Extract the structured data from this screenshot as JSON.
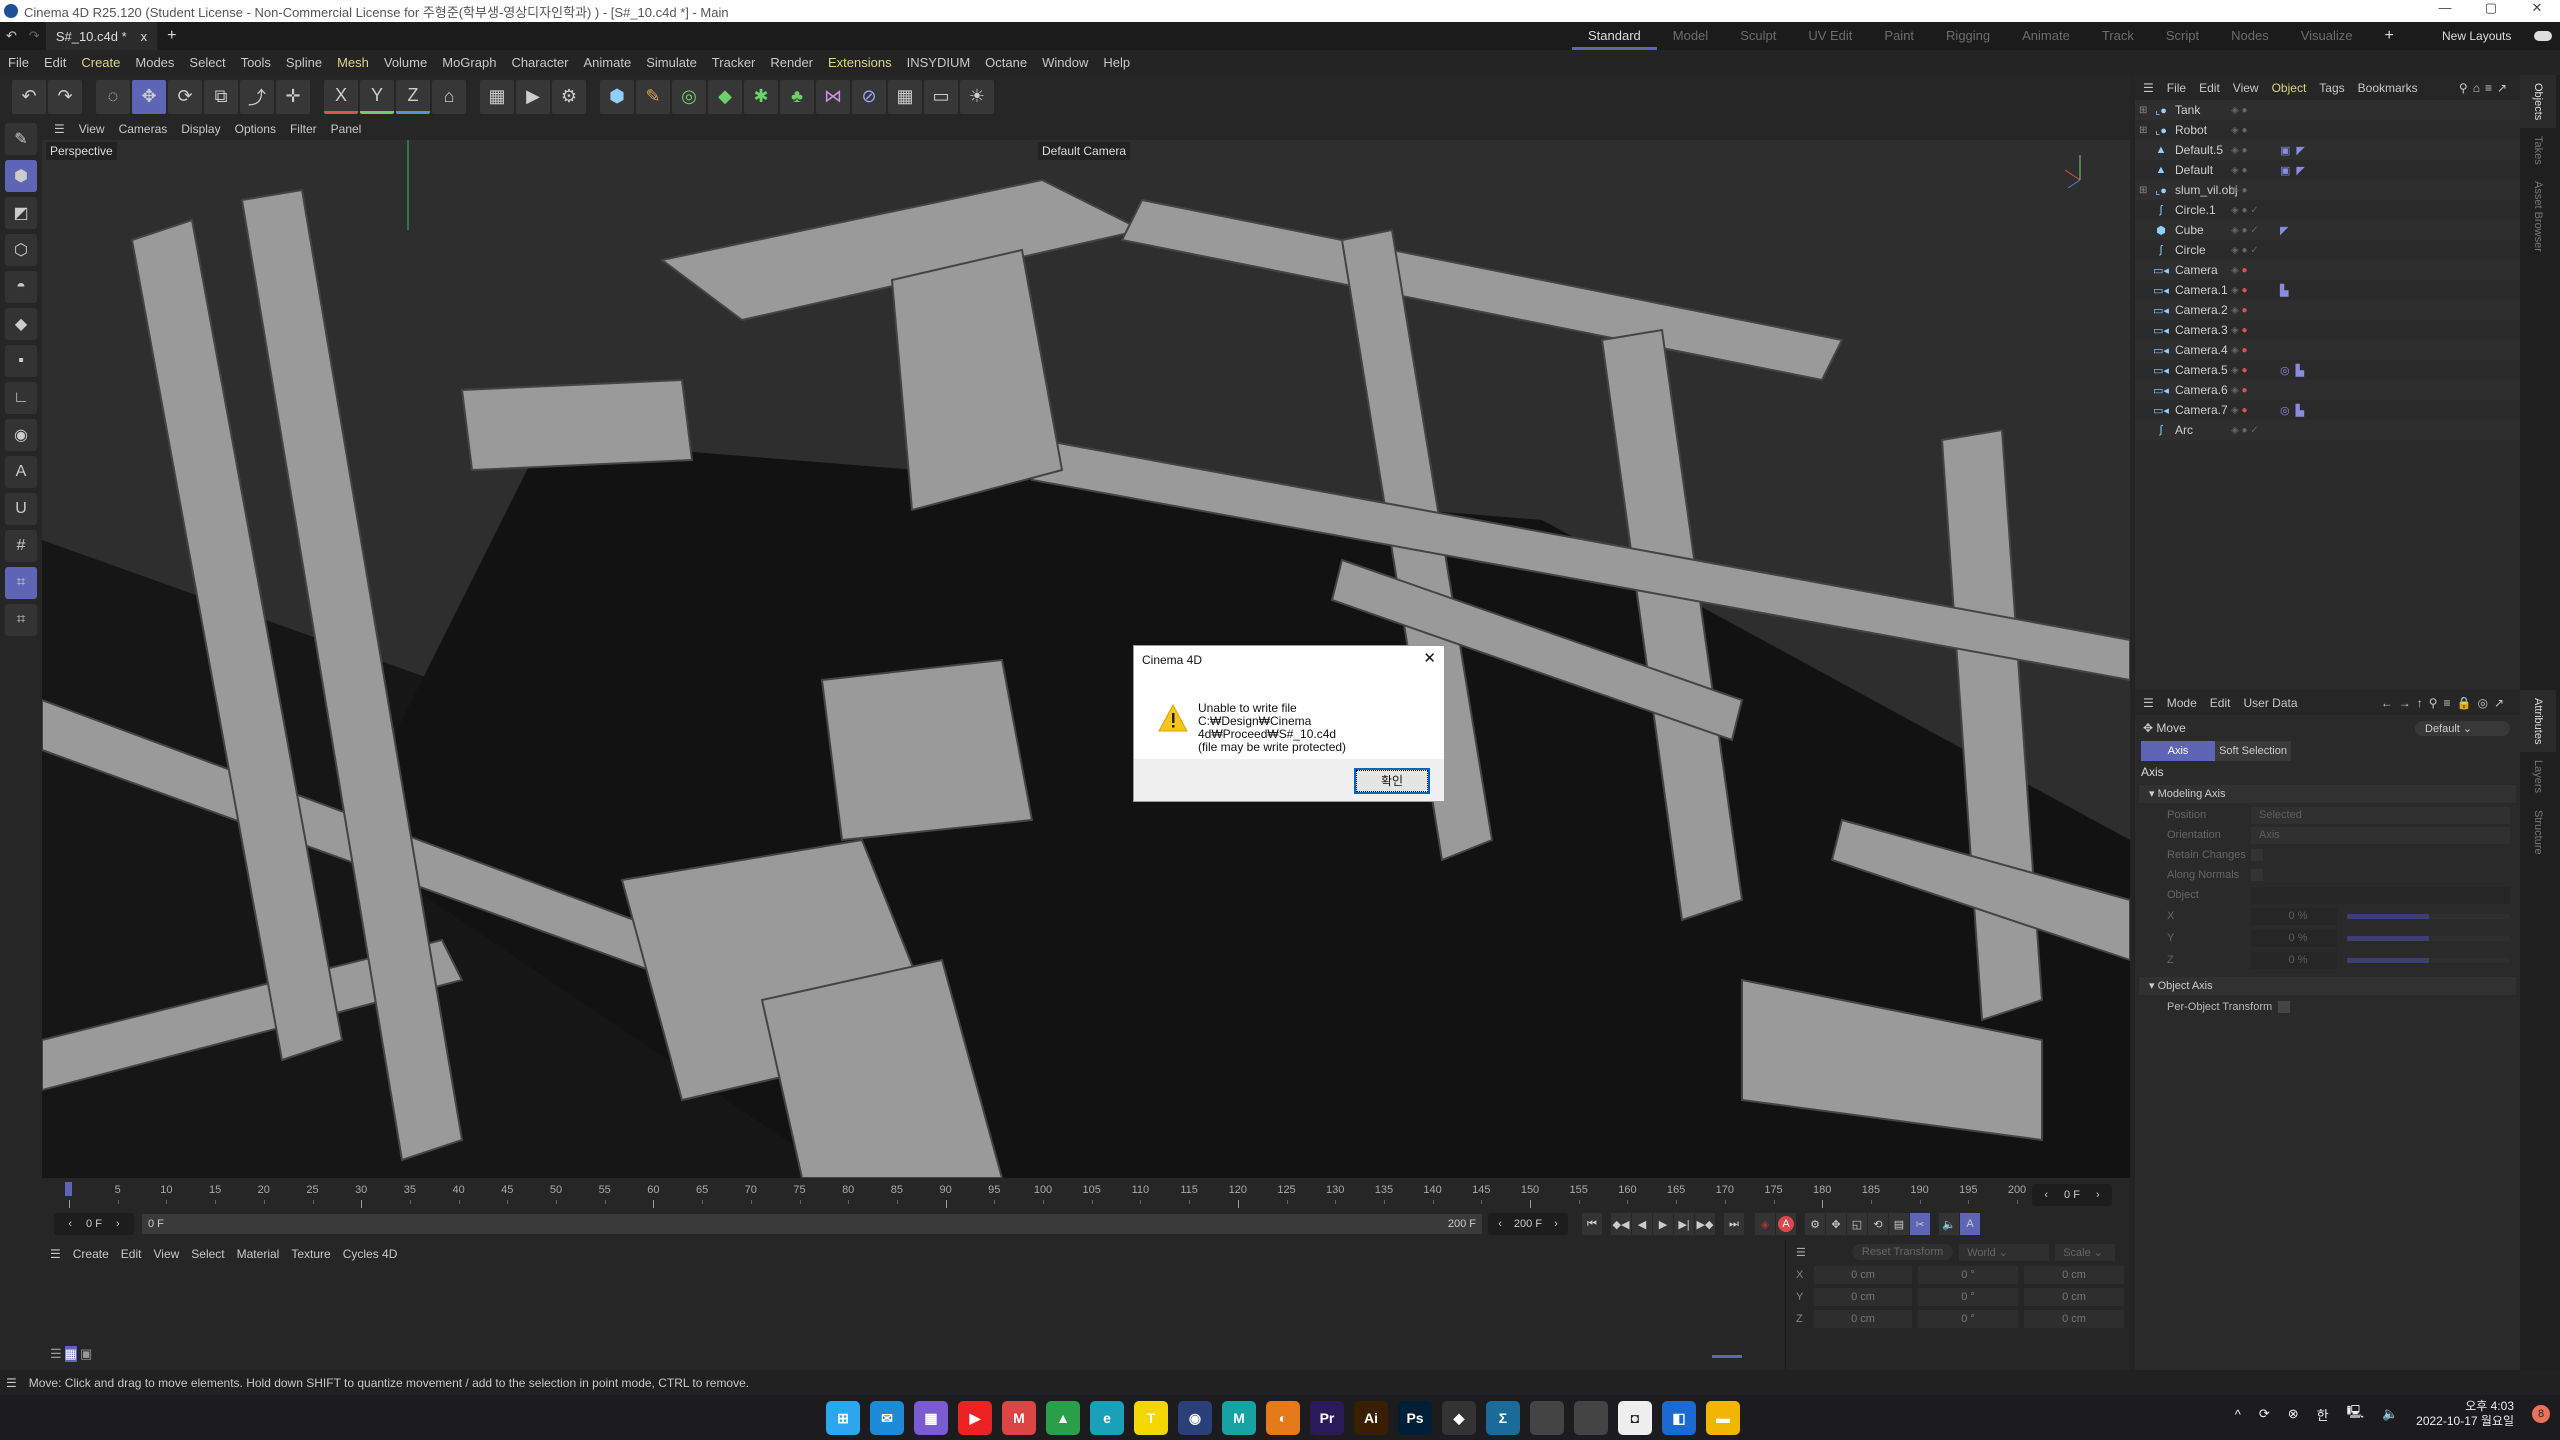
{
  "window": {
    "title": "Cinema 4D R25.120 (Student License - Non-Commercial License for 주형준(학부생-영상디자인학과) ) - [S#_10.c4d *] - Main",
    "controls": [
      "—",
      "▢",
      "✕"
    ]
  },
  "tabs": {
    "document": "S#_10.c4d *",
    "close": "x",
    "add": "+"
  },
  "layouts": {
    "items": [
      "Standard",
      "Model",
      "Sculpt",
      "UV Edit",
      "Paint",
      "Rigging",
      "Animate",
      "Track",
      "Script",
      "Nodes",
      "Visualize"
    ],
    "active": "Standard",
    "add": "+",
    "new_layouts": "New Layouts"
  },
  "menu": [
    "File",
    "Edit",
    "Create",
    "Modes",
    "Select",
    "Tools",
    "Spline",
    "Mesh",
    "Volume",
    "MoGraph",
    "Character",
    "Animate",
    "Simulate",
    "Tracker",
    "Render",
    "Extensions",
    "INSYDIUM",
    "Octane",
    "Window",
    "Help"
  ],
  "menu_highlight": [
    "Create",
    "Mesh",
    "Extensions"
  ],
  "toolbar_icons": [
    "undo-icon",
    "redo-icon",
    "live-selection-icon",
    "move-icon",
    "rotate-icon",
    "scale-icon",
    "recent-tools-icon",
    "transform-icon",
    "x-axis-icon",
    "y-axis-icon",
    "z-axis-icon",
    "coordinate-system-icon",
    "render-view-icon",
    "render-to-picture-viewer-icon",
    "render-settings-icon",
    "cube-icon",
    "pen-icon",
    "subdivision-icon",
    "extrude-icon",
    "cloner-icon",
    "fracture-icon",
    "deformer-icon",
    "field-icon",
    "floor-grid-icon",
    "camera-icon",
    "light-icon"
  ],
  "toolbar_glyphs": [
    "↶",
    "↷",
    "◌",
    "✥",
    "⟳",
    "⧉",
    "⤴",
    "✛",
    "X",
    "Y",
    "Z",
    "⌂",
    "▦",
    "▶",
    "⚙",
    "⬢",
    "✎",
    "◎",
    "◆",
    "✱",
    "♣",
    "⋈",
    "⊘",
    "▦",
    "▭",
    "☀"
  ],
  "viewport": {
    "menu": [
      "View",
      "Cameras",
      "Display",
      "Options",
      "Filter",
      "Panel"
    ],
    "projection": "Perspective",
    "camera": "Default Camera"
  },
  "dialog": {
    "title": "Cinema 4D",
    "line1": "Unable to write file",
    "line2": "C:₩Design₩Cinema 4d₩Proceed₩S#_10.c4d",
    "line3": "(file may be write protected)",
    "ok": "확인",
    "close": "✕",
    "icon": "warning-icon"
  },
  "object_manager": {
    "menu": [
      "File",
      "Edit",
      "View",
      "Object",
      "Tags",
      "Bookmarks"
    ],
    "objects": [
      {
        "name": "Tank",
        "icon": "null-icon",
        "tags": []
      },
      {
        "name": "Robot",
        "icon": "null-icon",
        "tags": []
      },
      {
        "name": "Default.5",
        "icon": "light-icon",
        "tags": [
          "texture-tag",
          "phong-tag"
        ]
      },
      {
        "name": "Default",
        "icon": "light-icon",
        "tags": [
          "texture-tag",
          "phong-tag"
        ]
      },
      {
        "name": "slum_vil.obj",
        "icon": "null-icon",
        "tags": []
      },
      {
        "name": "Circle.1",
        "icon": "spline-icon",
        "tags": []
      },
      {
        "name": "Cube",
        "icon": "cube-icon",
        "tags": [
          "phong-tag"
        ]
      },
      {
        "name": "Circle",
        "icon": "spline-icon",
        "tags": []
      },
      {
        "name": "Camera",
        "icon": "camera-icon",
        "tags": []
      },
      {
        "name": "Camera.1",
        "icon": "camera-icon",
        "tags": [
          "protection-tag"
        ]
      },
      {
        "name": "Camera.2",
        "icon": "camera-icon",
        "tags": []
      },
      {
        "name": "Camera.3",
        "icon": "camera-icon",
        "tags": []
      },
      {
        "name": "Camera.4",
        "icon": "camera-icon",
        "tags": []
      },
      {
        "name": "Camera.5",
        "icon": "camera-icon",
        "tags": [
          "target-tag",
          "protection-tag"
        ]
      },
      {
        "name": "Camera.6",
        "icon": "camera-icon",
        "tags": []
      },
      {
        "name": "Camera.7",
        "icon": "camera-icon",
        "tags": [
          "target-tag",
          "protection-tag"
        ]
      },
      {
        "name": "Arc",
        "icon": "spline-icon",
        "tags": []
      }
    ]
  },
  "side_tabs": {
    "top": [
      "Objects",
      "Takes",
      "Asset Browser"
    ],
    "bottom": [
      "Attributes",
      "Layers",
      "Structure"
    ]
  },
  "attributes": {
    "menu": [
      "Mode",
      "Edit",
      "User Data"
    ],
    "tool": "Move",
    "preset": "Default",
    "tabs": [
      "Axis",
      "Soft Selection"
    ],
    "active_tab": "Axis",
    "heading": "Axis",
    "modeling_axis": {
      "title": "Modeling Axis",
      "position_label": "Position",
      "position": "Selected",
      "orientation_label": "Orientation",
      "orientation": "Axis",
      "retain_label": "Retain Changes",
      "normals_label": "Along Normals",
      "object_label": "Object",
      "xyz": [
        {
          "label": "X",
          "value": "0 %",
          "level": 0.5
        },
        {
          "label": "Y",
          "value": "0 %",
          "level": 0.5
        },
        {
          "label": "Z",
          "value": "0 %",
          "level": 0.5
        }
      ]
    },
    "object_axis": {
      "title": "Object Axis",
      "per_object_label": "Per-Object Transform"
    }
  },
  "timeline": {
    "start": 0,
    "end": 200,
    "step": 5,
    "current": "0 F",
    "current_right": "0 F",
    "range_start": "0 F",
    "range_end": "200 F",
    "max": "200 F"
  },
  "material": {
    "menu": [
      "Create",
      "Edit",
      "View",
      "Select",
      "Material",
      "Texture",
      "Cycles 4D"
    ]
  },
  "coordinates": {
    "reset": "Reset Transform",
    "space": "World",
    "mode": "Scale",
    "rows": [
      {
        "axis": "X",
        "pos": "0 cm",
        "rot": "0 °",
        "size": "0 cm"
      },
      {
        "axis": "Y",
        "pos": "0 cm",
        "rot": "0 °",
        "size": "0 cm"
      },
      {
        "axis": "Z",
        "pos": "0 cm",
        "rot": "0 °",
        "size": "0 cm"
      }
    ]
  },
  "status": "Move: Click and drag to move elements. Hold down SHIFT to quantize movement / add to the selection in point mode, CTRL to remove.",
  "taskbar": {
    "apps": [
      {
        "icon": "windows-start-icon",
        "g": "⊞",
        "c": "#2aa7ee"
      },
      {
        "icon": "mail-icon",
        "g": "✉",
        "c": "#1d8ad8"
      },
      {
        "icon": "calendar-icon",
        "g": "▦",
        "c": "#7a5bd1"
      },
      {
        "icon": "youtube-icon",
        "g": "▶",
        "c": "#e22"
      },
      {
        "icon": "gmail-icon",
        "g": "M",
        "c": "#d44"
      },
      {
        "icon": "google-drive-icon",
        "g": "▲",
        "c": "#2a9f4a"
      },
      {
        "icon": "edge-icon",
        "g": "e",
        "c": "#1aa0b8"
      },
      {
        "icon": "kakaotalk-icon",
        "g": "T",
        "c": "#f5d700"
      },
      {
        "icon": "cinema4d-icon",
        "g": "◉",
        "c": "#2b3f7a"
      },
      {
        "icon": "maxon-icon",
        "g": "M",
        "c": "#16a3a3"
      },
      {
        "icon": "blender-icon",
        "g": "◐",
        "c": "#e57a1a"
      },
      {
        "icon": "premiere-icon",
        "g": "Pr",
        "c": "#2a1a5a"
      },
      {
        "icon": "illustrator-icon",
        "g": "Ai",
        "c": "#3a1e00"
      },
      {
        "icon": "photoshop-icon",
        "g": "Ps",
        "c": "#001e36"
      },
      {
        "icon": "app-icon",
        "g": "◆",
        "c": "#333"
      },
      {
        "icon": "app-icon-2",
        "g": "Σ",
        "c": "#1a6a9a"
      },
      {
        "icon": "apple-icon",
        "g": "",
        "c": "#444"
      },
      {
        "icon": "apple-icon-2",
        "g": "",
        "c": "#444"
      },
      {
        "icon": "app-icon-3",
        "g": "◘",
        "c": "#eee"
      },
      {
        "icon": "app-icon-4",
        "g": "◧",
        "c": "#1a6ad0"
      },
      {
        "icon": "file-explorer-icon",
        "g": "▬",
        "c": "#f2b600"
      }
    ],
    "tray": {
      "ime": "한",
      "time": "오후 4:03",
      "date": "2022-10-17 월요일",
      "badge": "8"
    }
  },
  "colors": {
    "accent": "#5f65b6",
    "menu_highlight": "#d7d78a",
    "record": "#e0474c"
  }
}
